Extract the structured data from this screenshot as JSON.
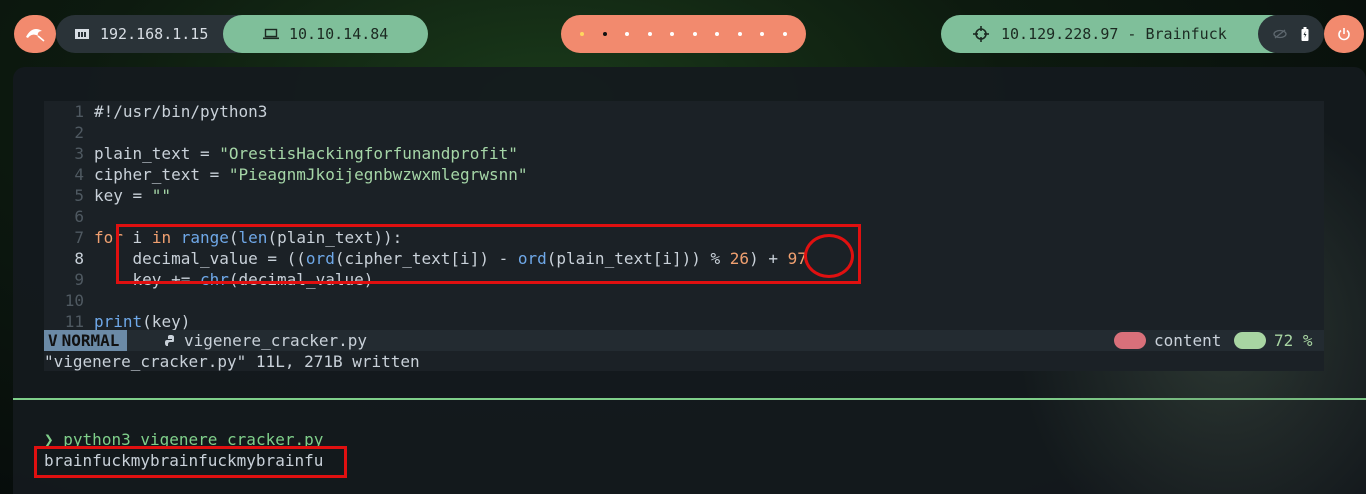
{
  "topbar": {
    "local_ip": "192.168.1.15",
    "vpn_ip": "10.10.14.84",
    "target": "10.129.228.97 - Brainfuck",
    "workspaces": [
      "active",
      "current",
      "dot",
      "dot",
      "dot",
      "dot",
      "dot",
      "dot",
      "dot",
      "dot"
    ],
    "icons": [
      "kali-dragon-icon",
      "network-icon",
      "laptop-icon",
      "crosshair-icon",
      "eye-off-icon",
      "battery-icon",
      "power-icon"
    ]
  },
  "editor": {
    "lines": [
      {
        "n": "1",
        "text": "#!/usr/bin/python3"
      },
      {
        "n": "2",
        "text": ""
      },
      {
        "n": "3",
        "pre": "plain_text = ",
        "str": "\"OrestisHackingforfunandprofit\""
      },
      {
        "n": "4",
        "pre": "cipher_text = ",
        "str": "\"PieagnmJkoijegnbwzwxmlegrwsnn\""
      },
      {
        "n": "5",
        "pre": "key = ",
        "str": "\"\""
      },
      {
        "n": "6",
        "text": ""
      },
      {
        "n": "7",
        "kw1": "for",
        "mid1": " i ",
        "kw2": "in",
        "sp": " ",
        "fn1": "range",
        "p1": "(",
        "fn2": "len",
        "rest": "(plain_text)):"
      },
      {
        "n": "8",
        "indent": "    decimal_value = ((",
        "fn1": "ord",
        "a1": "(cipher_text[i]) - ",
        "fn2": "ord",
        "a2": "(plain_text[i])) % ",
        "num1": "26",
        "a3": ") + ",
        "num2": "97"
      },
      {
        "n": "9",
        "indent": "    key += ",
        "fn1": "chr",
        "rest": "(decimal_value)"
      },
      {
        "n": "10",
        "text": ""
      },
      {
        "n": "11",
        "fn1": "print",
        "rest": "(key)"
      }
    ],
    "current_line": "8",
    "status": {
      "mode": "NORMAL",
      "filename": "vigenere_cracker.py",
      "filetype": "content",
      "percent": "72 %"
    },
    "message": "\"vigenere_cracker.py\" 11L, 271B written"
  },
  "shell": {
    "prompt_symbol": "❯",
    "command": "python3 vigenere_cracker.py",
    "output": "brainfuckmybrainfuckmybrainfu"
  },
  "colors": {
    "accent_orange": "#f28a6e",
    "accent_green": "#7fbf9a",
    "highlight_red": "#e01010"
  }
}
